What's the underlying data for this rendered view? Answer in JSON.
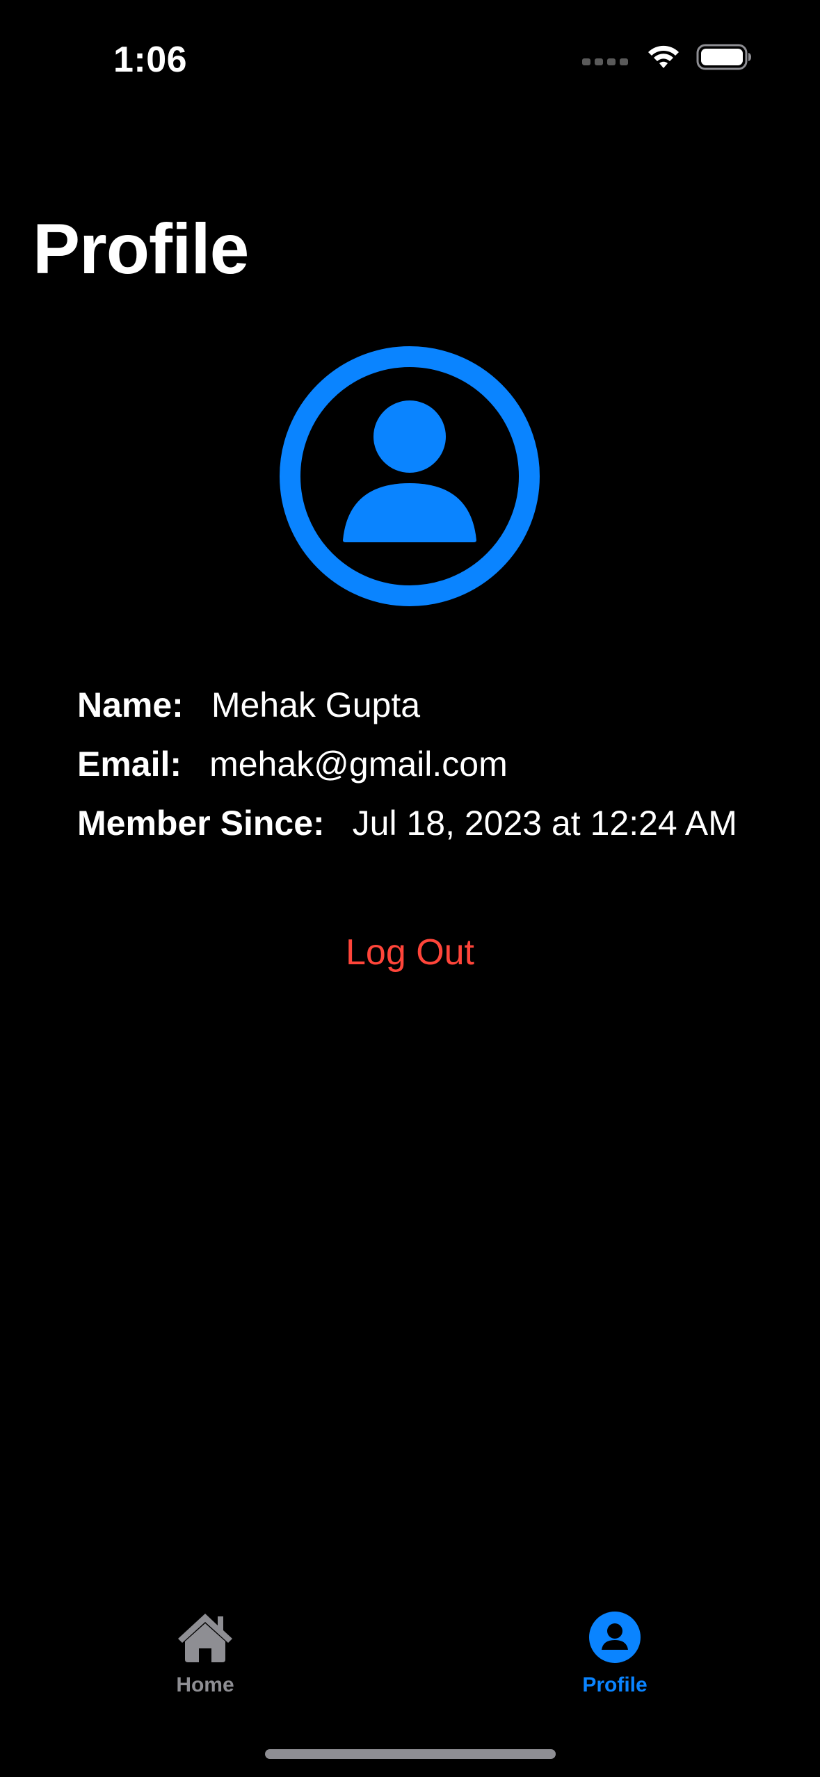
{
  "status_bar": {
    "time": "1:06",
    "icons": [
      "cellular-signal-icon",
      "wifi-icon",
      "battery-icon"
    ]
  },
  "page": {
    "title": "Profile"
  },
  "avatar": {
    "icon": "person-circle-icon",
    "color": "#0a84ff"
  },
  "profile_info": {
    "name_label": "Name:",
    "name_value": "Mehak Gupta",
    "email_label": "Email:",
    "email_value": "mehak@gmail.com",
    "member_since_label": "Member Since:",
    "member_since_value": "Jul 18, 2023 at 12:24 AM"
  },
  "actions": {
    "logout_label": "Log Out",
    "logout_color": "#ff453a"
  },
  "tab_bar": {
    "tabs": [
      {
        "label": "Home",
        "icon": "house-icon",
        "selected": false
      },
      {
        "label": "Profile",
        "icon": "person-circle-fill-icon",
        "selected": true
      }
    ],
    "selected_color": "#0a84ff",
    "unselected_color": "#8e8e93"
  }
}
